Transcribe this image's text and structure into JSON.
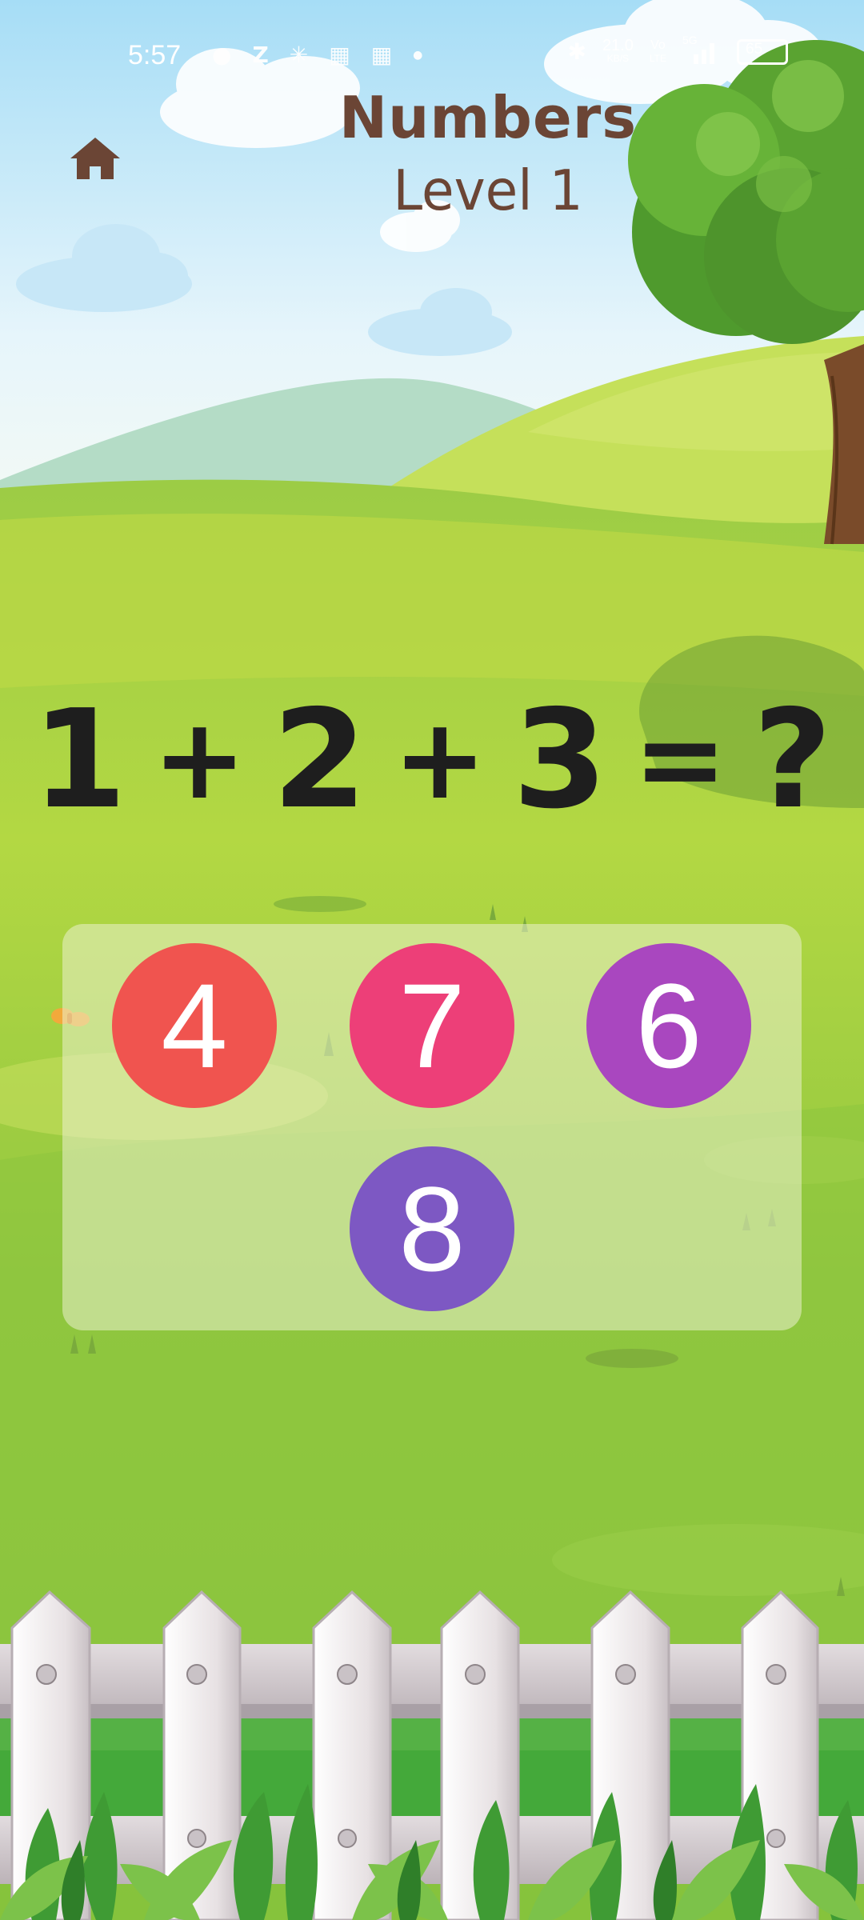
{
  "status_bar": {
    "time": "5:57",
    "icons_left": [
      "security-icon",
      "z-app-icon",
      "pinwheel-icon",
      "grid-app-icon",
      "grid-app-icon",
      "dot-icon"
    ],
    "network_speed": "21.0",
    "network_speed_unit": "KB/S",
    "volte": "Vo",
    "volte_sub": "LTE",
    "signal_label": "5G",
    "battery": "65"
  },
  "header": {
    "title": "Numbers",
    "level": "Level 1",
    "home_icon": "home-icon"
  },
  "question": {
    "parts": [
      "1",
      "+",
      "2",
      "+",
      "3",
      "=",
      "?"
    ]
  },
  "answers": [
    {
      "value": "4",
      "color": "#f0544f"
    },
    {
      "value": "7",
      "color": "#ed3f78"
    },
    {
      "value": "6",
      "color": "#a947bf"
    },
    {
      "value": "8",
      "color": "#7d58c3"
    }
  ],
  "colors": {
    "title": "#6b4535",
    "sky_top": "#a6ddf6",
    "grass": "#8ec63f"
  }
}
